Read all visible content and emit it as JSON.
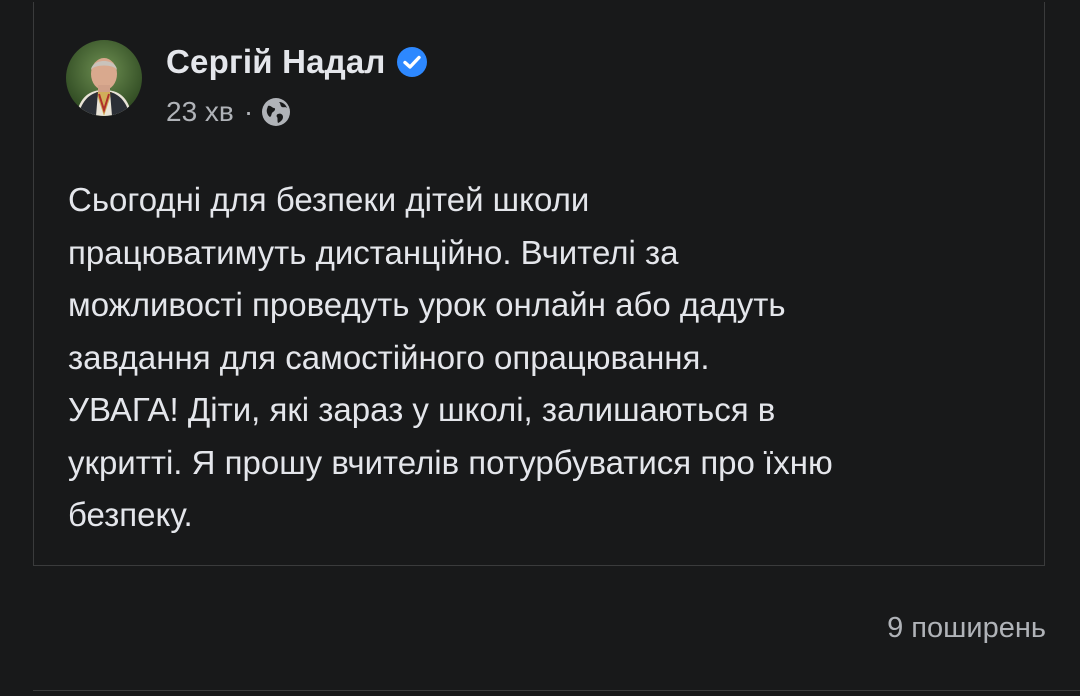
{
  "post": {
    "author": "Сергій Надал",
    "time": "23 хв",
    "separator": "·",
    "privacy_icon": "globe-icon",
    "verified_icon": "verified-badge-icon",
    "text": "Сьогодні для безпеки дітей школи\nпрацюватимуть дистанційно. Вчителі за\nможливості проведуть урок онлайн або дадуть\nзавдання для самостійного опрацювання.\nУВАГА! Діти, які зараз у школі, залишаються в\nукритті. Я прошу вчителів потурбуватися про їхню\nбезпеку."
  },
  "footer": {
    "shares": "9 поширень"
  },
  "colors": {
    "background": "#18191a",
    "text_primary": "#e4e6eb",
    "text_secondary": "#b0b3b8",
    "verified_blue": "#2d88ff",
    "border": "#3a3b3c"
  }
}
